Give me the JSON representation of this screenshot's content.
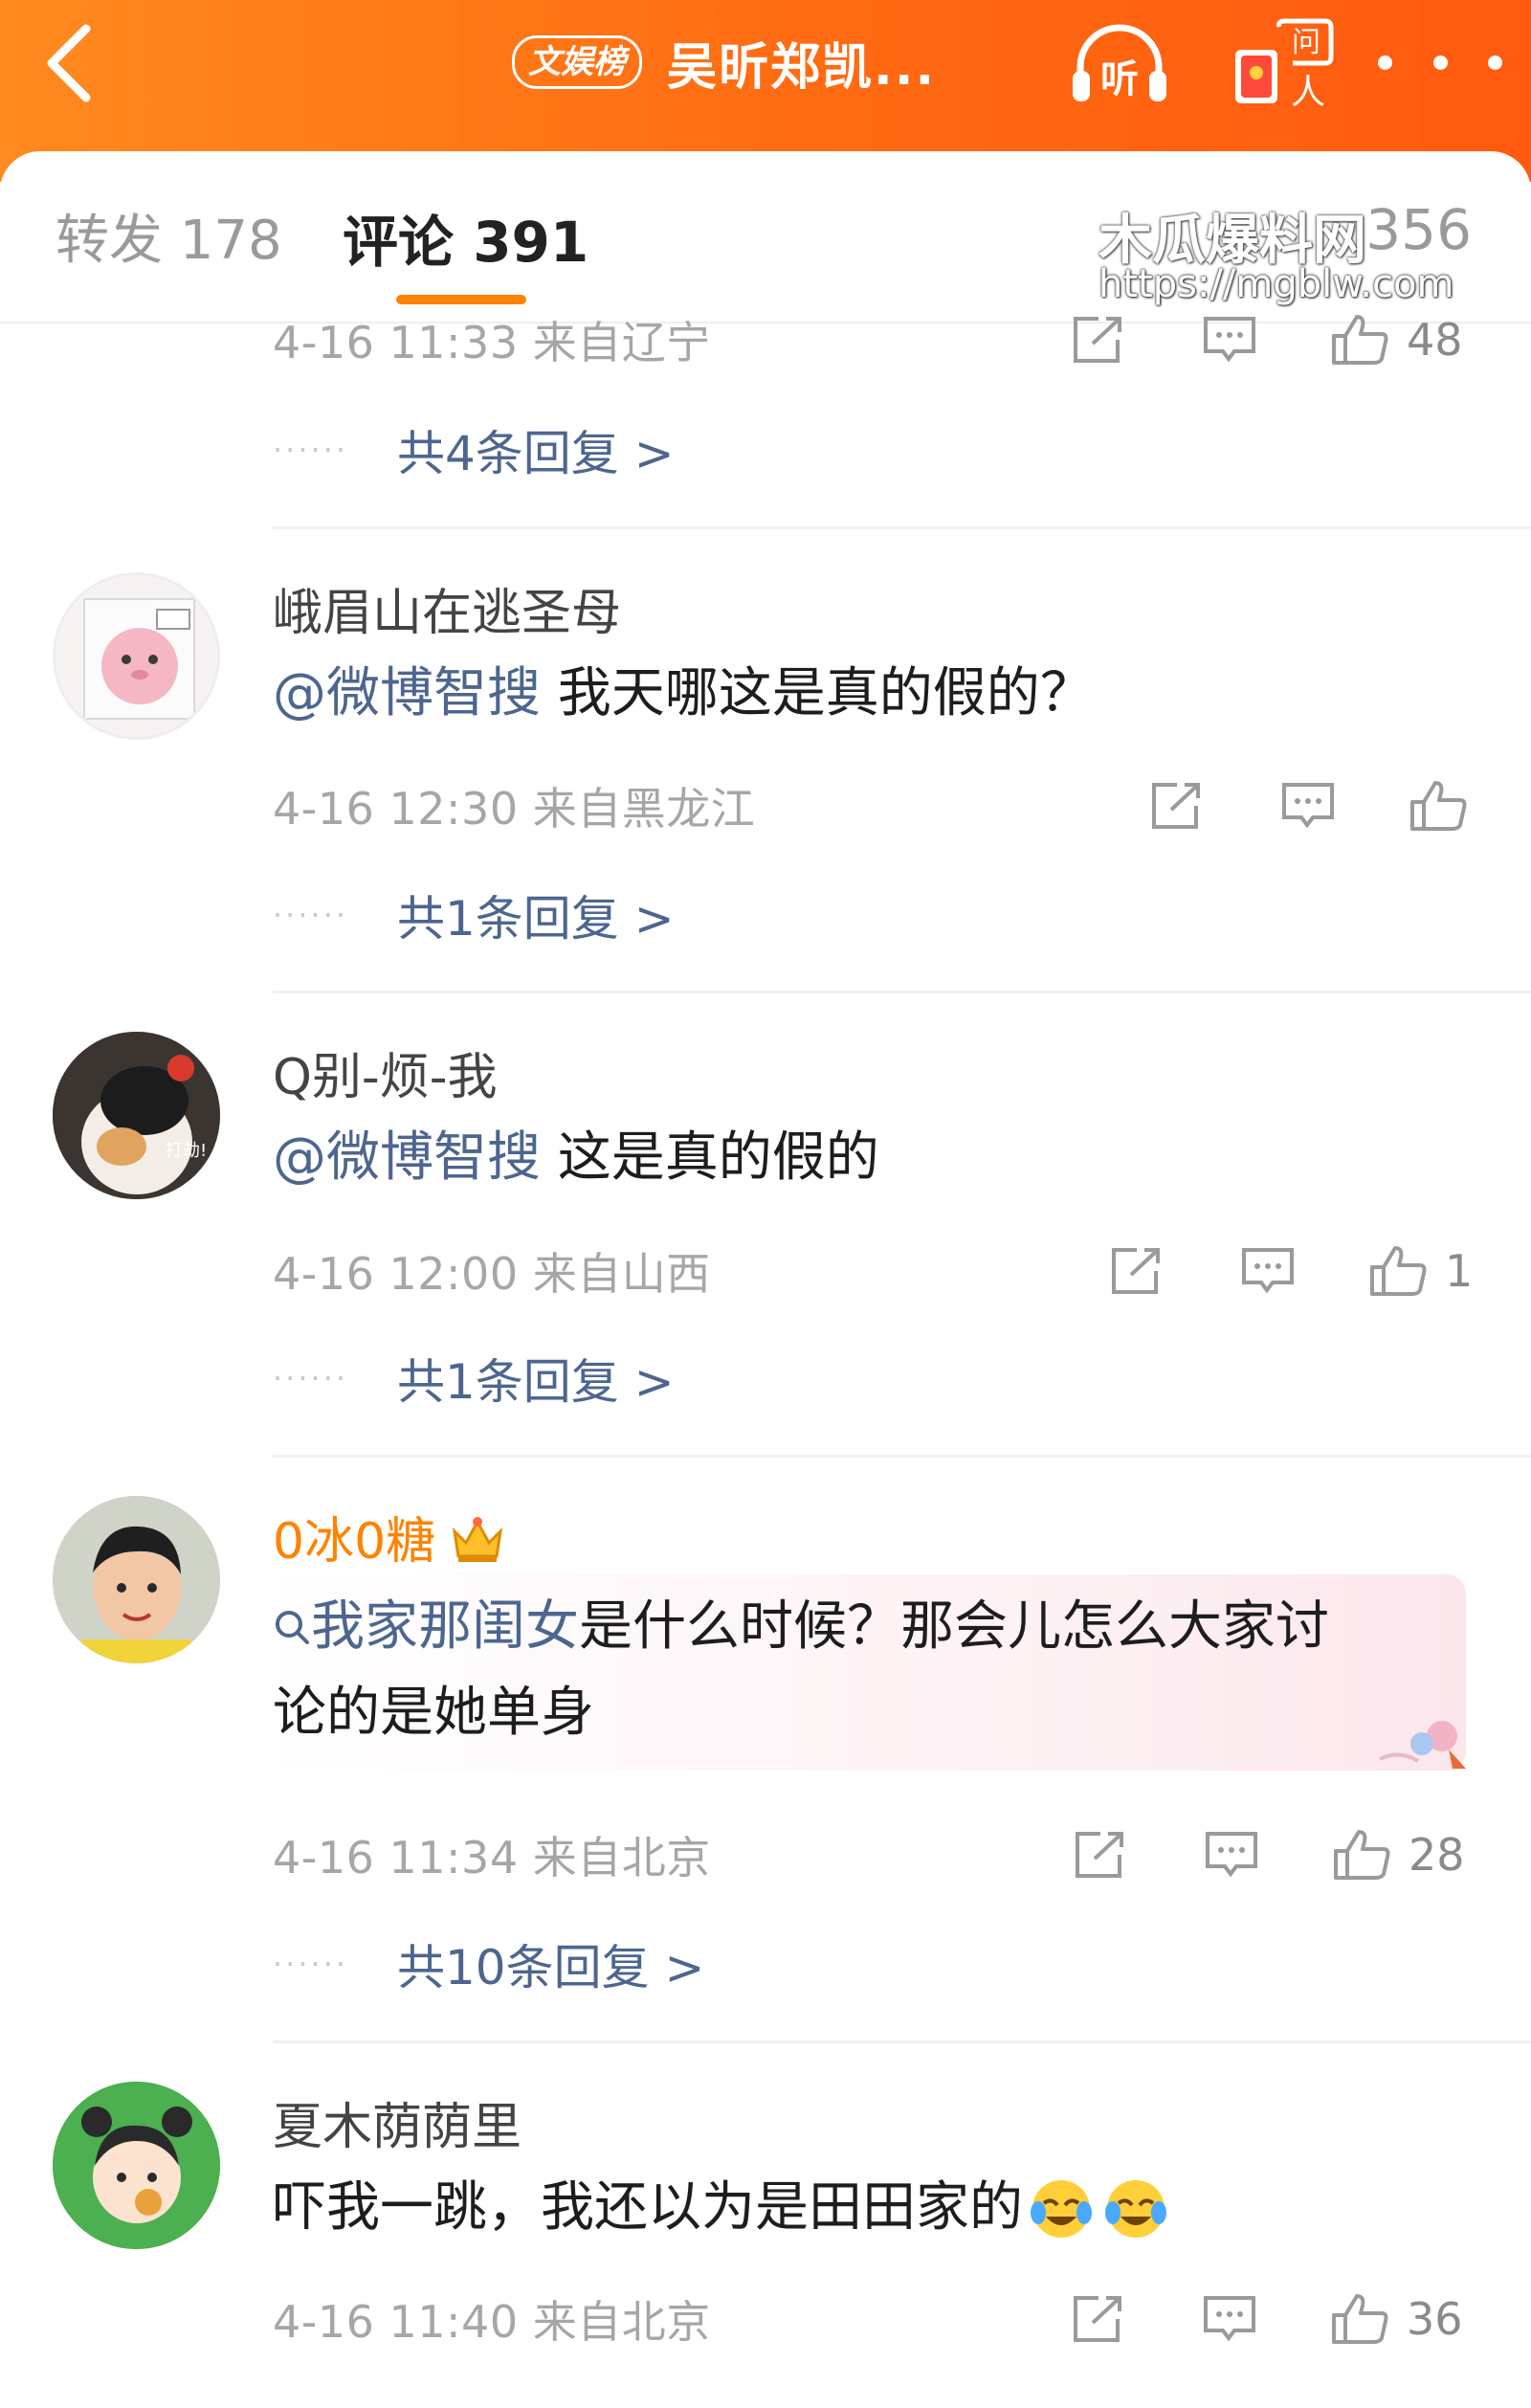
{
  "header": {
    "back_icon": "chevron-left-icon",
    "badge": "文娱榜",
    "title": "吴昕郑凯...",
    "listen_label": "听",
    "ask_label": "问人",
    "more_icon": "more-dots-icon"
  },
  "tabs": {
    "repost": "转发 178",
    "comment": "评论 391",
    "likes": "356"
  },
  "watermark": {
    "title": "木瓜爆料网",
    "url": "https://mgblw.com"
  },
  "comments": [
    {
      "meta": "4-16 11:33  来自辽宁",
      "likes": "48",
      "replies": "共4条回复 >"
    },
    {
      "user": "峨眉山在逃圣母",
      "mention": "@微博智搜",
      "text": "  我天哪这是真的假的？",
      "meta": "4-16 12:30  来自黑龙江",
      "likes": "",
      "replies": "共1条回复 >"
    },
    {
      "user": "Q别-烦-我",
      "mention": "@微博智搜",
      "text": " 这是真的假的",
      "meta": "4-16 12:00  来自山西",
      "likes": "1",
      "replies": "共1条回复 >"
    },
    {
      "user": "0冰0糖",
      "topic": "我家那闺女",
      "text_line1": "是什么时候？那会儿怎么大家讨",
      "text_line2": "论的是她单身",
      "meta": "4-16 11:34  来自北京",
      "likes": "28",
      "replies": "共10条回复 >"
    },
    {
      "user": "夏木荫荫里",
      "text": "吓我一跳，我还以为是田田家的",
      "meta": "4-16 11:40  来自北京",
      "likes": "36"
    }
  ],
  "colors": {
    "header_orange": "#ff6a12",
    "link_blue": "#4d6690",
    "vip_name_orange": "#ff8200",
    "meta_gray": "#a6a6a6"
  }
}
